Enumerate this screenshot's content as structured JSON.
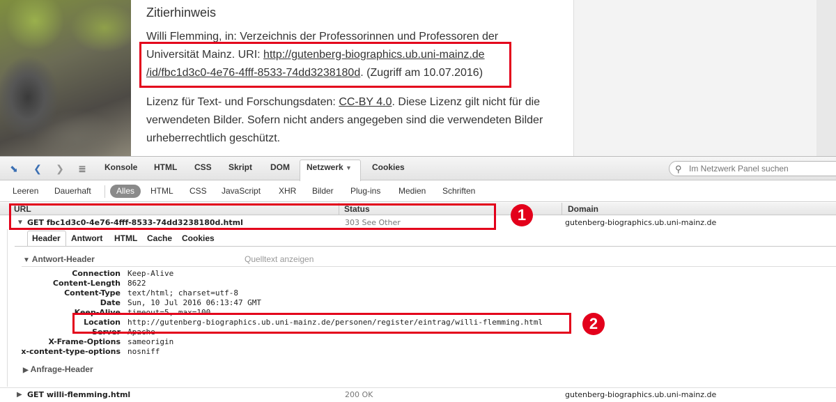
{
  "article": {
    "heading": "Zitierhinweis",
    "cite_line1": "Willi Flemming, in: Verzeichnis der Professorinnen und Professoren der",
    "cite_line2_prefix": "Universität Mainz. URI: ",
    "cite_link1": "http://gutenberg-biographics.ub.uni-mainz.de",
    "cite_link2": "/id/fbc1d3c0-4e76-4fff-8533-74dd3238180d",
    "cite_suffix": ". (Zugriff am 10.07.2016)",
    "license_prefix": "Lizenz für Text- und Forschungsdaten: ",
    "license_link": "CC-BY 4.0",
    "license_line1_suffix": ". Diese Lizenz gilt nicht für die",
    "license_line2": "verwendeten Bilder. Sofern nicht anders angegeben sind die verwendeten Bilder",
    "license_line3": "urheberrechtlich geschützt."
  },
  "devtools": {
    "tabs": [
      "Konsole",
      "HTML",
      "CSS",
      "Skript",
      "DOM",
      "Netzwerk",
      "Cookies"
    ],
    "active_tab": "Netzwerk",
    "search_placeholder": "Im Netzwerk Panel suchen",
    "filters": [
      "Leeren",
      "Dauerhaft",
      "Alles",
      "HTML",
      "CSS",
      "JavaScript",
      "XHR",
      "Bilder",
      "Plug-ins",
      "Medien",
      "Schriften"
    ],
    "active_filter": "Alles",
    "columns": {
      "url": "URL",
      "status": "Status",
      "domain": "Domain"
    },
    "requests": [
      {
        "name": "GET fbc1d3c0-4e76-4fff-8533-74dd3238180d.html",
        "status": "303 See Other",
        "domain": "gutenberg-biographics.ub.uni-mainz.de",
        "expanded": true
      },
      {
        "name": "GET willi-flemming.html",
        "status": "200 OK",
        "domain": "gutenberg-biographics.ub.uni-mainz.de",
        "expanded": false
      }
    ],
    "detail_tabs": [
      "Header",
      "Antwort",
      "HTML",
      "Cache",
      "Cookies"
    ],
    "active_detail_tab": "Header",
    "response_section": "Antwort-Header",
    "view_source": "Quelltext anzeigen",
    "request_section": "Anfrage-Header",
    "headers": [
      {
        "key": "Connection",
        "value": "Keep-Alive"
      },
      {
        "key": "Content-Length",
        "value": "8622"
      },
      {
        "key": "Content-Type",
        "value": "text/html; charset=utf-8"
      },
      {
        "key": "Date",
        "value": "Sun, 10 Jul 2016 06:13:47 GMT"
      },
      {
        "key": "Keep-Alive",
        "value": "timeout=5, max=100"
      },
      {
        "key": "Location",
        "value": "http://gutenberg-biographics.ub.uni-mainz.de/personen/register/eintrag/willi-flemming.html"
      },
      {
        "key": "Server",
        "value": "Apache"
      },
      {
        "key": "X-Frame-Options",
        "value": "sameorigin"
      },
      {
        "key": "x-content-type-options",
        "value": "nosniff"
      }
    ]
  },
  "annotations": {
    "badge1": "1",
    "badge2": "2"
  },
  "colors": {
    "highlight": "#e3001b",
    "link_blue": "#3a6fb3"
  }
}
